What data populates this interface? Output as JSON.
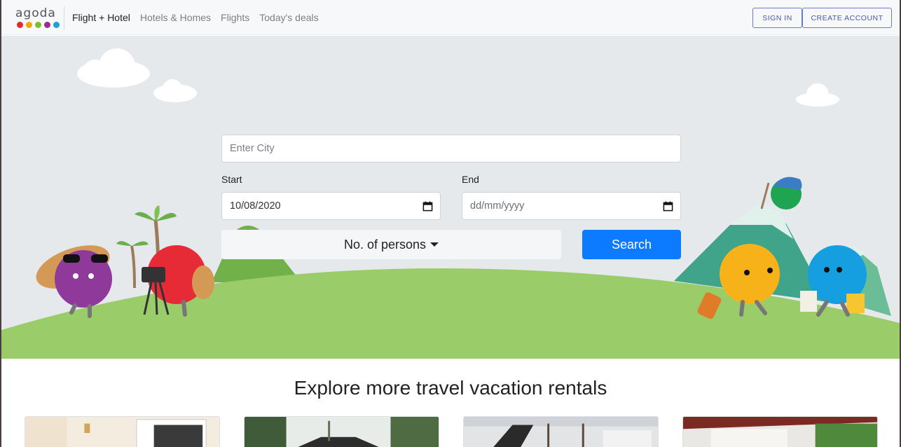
{
  "brand": {
    "name": "agoda",
    "dot_colors": [
      "#e6282d",
      "#f7a600",
      "#7bbf2f",
      "#9b2d8f",
      "#1ba1dc"
    ]
  },
  "nav": {
    "links": [
      {
        "label": "Flight + Hotel",
        "active": true
      },
      {
        "label": "Hotels & Homes",
        "active": false
      },
      {
        "label": "Flights",
        "active": false
      },
      {
        "label": "Today's deals",
        "active": false
      }
    ],
    "sign_in": "SIGN IN",
    "create_account": "CREATE ACCOUNT"
  },
  "search": {
    "city_placeholder": "Enter City",
    "start_label": "Start",
    "start_value": "10/08/2020",
    "end_label": "End",
    "end_placeholder": "dd/mm/yyyy",
    "persons_label": "No. of persons",
    "search_label": "Search"
  },
  "explore": {
    "title": "Explore more travel vacation rentals",
    "cards": [
      {
        "name": "rental-card-1",
        "icon": "bedroom-photo"
      },
      {
        "name": "rental-card-2",
        "icon": "villa-photo"
      },
      {
        "name": "rental-card-3",
        "icon": "patio-photo"
      },
      {
        "name": "rental-card-4",
        "icon": "terrace-photo"
      }
    ]
  },
  "colors": {
    "accent": "#0d7bff",
    "hero_bg": "#e6e9ec",
    "grass": "#9acd6a"
  }
}
